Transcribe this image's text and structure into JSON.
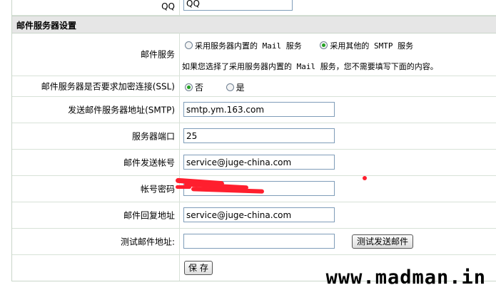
{
  "top_row": {
    "label": "QQ",
    "value": "QQ"
  },
  "section": {
    "title": "邮件服务器设置"
  },
  "mail_service": {
    "label": "邮件服务",
    "option_builtin": "采用服务器内置的 Mail 服务",
    "option_smtp": "采用其他的 SMTP 服务",
    "selected": "smtp",
    "hint": "如果您选择了采用服务器内置的 Mail 服务，您不需要填写下面的内容。"
  },
  "ssl": {
    "label": "邮件服务器是否要求加密连接(SSL)",
    "option_no": "否",
    "option_yes": "是",
    "selected": "no"
  },
  "smtp_host": {
    "label": "发送邮件服务器地址(SMTP)",
    "value": "smtp.ym.163.com"
  },
  "port": {
    "label": "服务器端口",
    "value": "25"
  },
  "account": {
    "label": "邮件发送帐号",
    "value": "service@juge-china.com"
  },
  "password": {
    "label": "帐号密码",
    "value": ""
  },
  "reply": {
    "label": "邮件回复地址",
    "value": "service@juge-china.com"
  },
  "test": {
    "label": "测试邮件地址:",
    "value": "",
    "button": "测试发送邮件"
  },
  "save_button": "保 存",
  "watermark": "www.madman.in",
  "colors": {
    "section_bg": "#e6e6e6",
    "radio_on": "#21a121",
    "scribble": "#ff1f2e"
  }
}
